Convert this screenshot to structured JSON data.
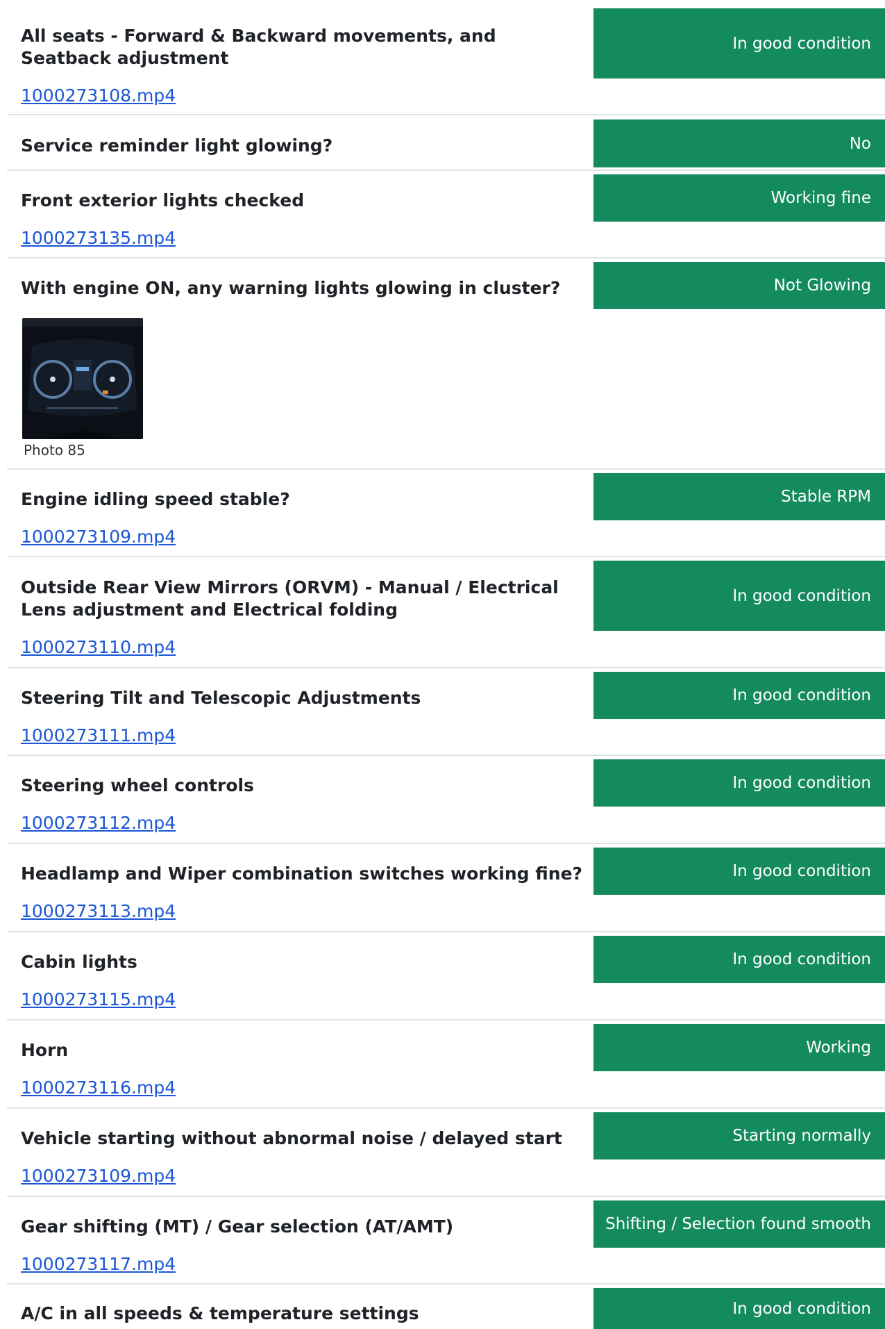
{
  "items": [
    {
      "label": "All seats - Forward & Backward movements, and Seatback adjustment",
      "status": "In good condition",
      "file": "1000273108.mp4"
    },
    {
      "label": "Service reminder light glowing?",
      "status": "No"
    },
    {
      "label": "Front exterior lights checked",
      "status": "Working fine",
      "file": "1000273135.mp4"
    },
    {
      "label": "With engine ON, any warning lights glowing in cluster?",
      "status": "Not Glowing",
      "photo_caption": "Photo 85"
    },
    {
      "label": "Engine idling speed stable?",
      "status": "Stable RPM",
      "file": "1000273109.mp4"
    },
    {
      "label": "Outside Rear View Mirrors (ORVM) - Manual / Electrical Lens adjustment and Electrical folding",
      "status": "In good condition",
      "file": "1000273110.mp4"
    },
    {
      "label": "Steering Tilt and Telescopic Adjustments",
      "status": "In good condition",
      "file": "1000273111.mp4"
    },
    {
      "label": "Steering wheel controls",
      "status": "In good condition",
      "file": "1000273112.mp4"
    },
    {
      "label": "Headlamp and Wiper combination switches working fine?",
      "status": "In good condition",
      "file": "1000273113.mp4"
    },
    {
      "label": "Cabin lights",
      "status": "In good condition",
      "file": "1000273115.mp4"
    },
    {
      "label": "Horn",
      "status": "Working",
      "file": "1000273116.mp4"
    },
    {
      "label": "Vehicle starting without abnormal noise / delayed start",
      "status": "Starting normally",
      "file": "1000273109.mp4"
    },
    {
      "label": "Gear shifting (MT) / Gear selection (AT/AMT)",
      "status": "Shifting / Selection found smooth",
      "file": "1000273117.mp4"
    },
    {
      "label": "A/C in all speeds & temperature settings",
      "status": "In good condition"
    }
  ],
  "colors": {
    "status_bg": "#148a5f",
    "link": "#1a56d6",
    "divider": "#dfe3ea"
  }
}
